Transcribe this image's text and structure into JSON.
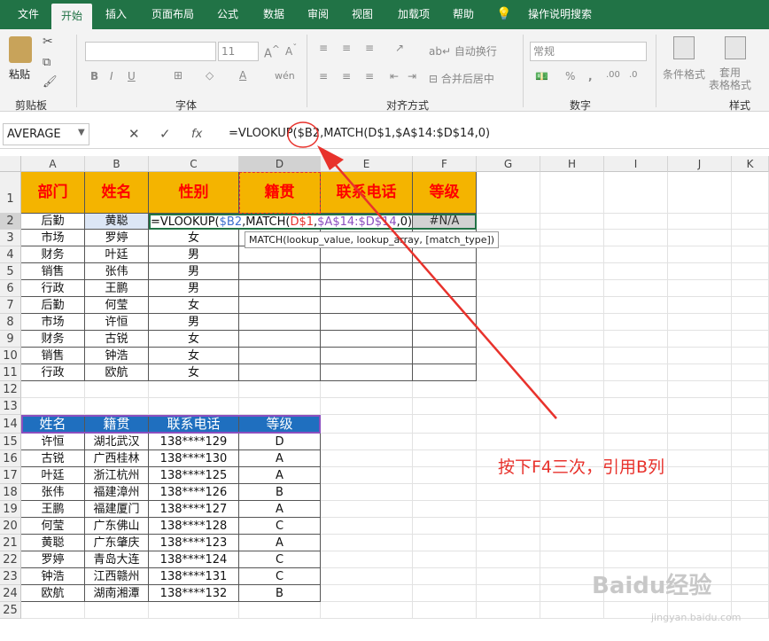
{
  "tabs": [
    "文件",
    "开始",
    "插入",
    "页面布局",
    "公式",
    "数据",
    "审阅",
    "视图",
    "加载项",
    "帮助",
    "操作说明搜索"
  ],
  "ribbon": {
    "paste_label": "粘贴",
    "clipboard_label": "剪贴板",
    "font_label": "字体",
    "font_size": "11",
    "align_label": "对齐方式",
    "wrap_label": "自动换行",
    "merge_label": "合并后居中",
    "number_label": "数字",
    "number_format": "常规",
    "styles_label": "样式",
    "cond_format_label": "条件格式",
    "table_format_label": "套用\n表格格式"
  },
  "formula_bar": {
    "name_box": "AVERAGE",
    "fx": "fx",
    "formula": "=VLOOKUP($B2,MATCH(D$1,$A$14:$D$14,0)"
  },
  "columns": [
    "A",
    "B",
    "C",
    "D",
    "E",
    "F",
    "G",
    "H",
    "I",
    "J",
    "K"
  ],
  "rows": [
    "1",
    "2",
    "3",
    "4",
    "5",
    "6",
    "7",
    "8",
    "9",
    "10",
    "11",
    "12",
    "13",
    "14",
    "15",
    "16",
    "17",
    "18",
    "19",
    "20",
    "21",
    "22",
    "23",
    "24",
    "25"
  ],
  "table1": {
    "headers": [
      "部门",
      "姓名",
      "性别",
      "籍贯",
      "联系电话",
      "等级"
    ],
    "rows": [
      [
        "后勤",
        "黄聪",
        ""
      ],
      [
        "市场",
        "罗婷",
        "女"
      ],
      [
        "财务",
        "叶廷",
        "男"
      ],
      [
        "销售",
        "张伟",
        "男"
      ],
      [
        "行政",
        "王鹏",
        "男"
      ],
      [
        "后勤",
        "何莹",
        "女"
      ],
      [
        "市场",
        "许恒",
        "男"
      ],
      [
        "财务",
        "古锐",
        "女"
      ],
      [
        "销售",
        "钟浩",
        "女"
      ],
      [
        "行政",
        "欧航",
        "女"
      ]
    ],
    "editing_formula": "=VLOOKUP($B2,MATCH(D$1,$A$14:$D$14,0)",
    "f2_value": "#N/A"
  },
  "tooltip": "MATCH(lookup_value, lookup_array, [match_type])",
  "table2": {
    "headers": [
      "姓名",
      "籍贯",
      "联系电话",
      "等级"
    ],
    "rows": [
      [
        "许恒",
        "湖北武汉",
        "138****129",
        "D"
      ],
      [
        "古锐",
        "广西桂林",
        "138****130",
        "A"
      ],
      [
        "叶廷",
        "浙江杭州",
        "138****125",
        "A"
      ],
      [
        "张伟",
        "福建漳州",
        "138****126",
        "B"
      ],
      [
        "王鹏",
        "福建厦门",
        "138****127",
        "A"
      ],
      [
        "何莹",
        "广东佛山",
        "138****128",
        "C"
      ],
      [
        "黄聪",
        "广东肇庆",
        "138****123",
        "A"
      ],
      [
        "罗婷",
        "青岛大连",
        "138****124",
        "C"
      ],
      [
        "钟浩",
        "江西赣州",
        "138****131",
        "C"
      ],
      [
        "欧航",
        "湖南湘潭",
        "138****132",
        "B"
      ]
    ]
  },
  "annotation": "按下F4三次，引用B列",
  "watermark": "Baidu经验",
  "watermark_sub": "jingyan.baidu.com",
  "colors": {
    "excel_green": "#217346",
    "header_orange": "#f4b400",
    "header_blue": "#1f6fbf",
    "annotation_red": "#e8322c"
  }
}
